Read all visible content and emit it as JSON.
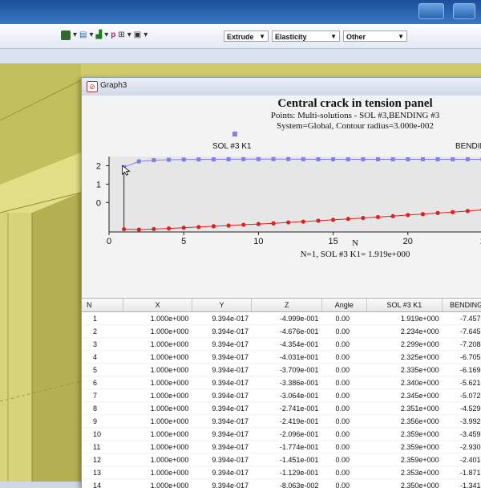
{
  "toolbar": {
    "combo_extrude": "Extrude",
    "combo_elasticity": "Elasticity",
    "combo_other": "Other"
  },
  "graph_window": {
    "title": "Graph3"
  },
  "chart_data": {
    "type": "line",
    "title": "Central crack in tension panel",
    "subtitle_lines": [
      "Points: Multi-solutions - SOL #3,BENDING #3",
      "System=Global, Contour radius=3.000e-002"
    ],
    "xlabel": "N",
    "footer": "N=1, SOL #3 K1= 1.919e+000",
    "xlim": [
      0,
      25
    ],
    "ylim": [
      -1.6,
      2.5
    ],
    "xticks": [
      0,
      5,
      10,
      15,
      20,
      25
    ],
    "xtick_labels": [
      "0",
      "5",
      "10",
      "15",
      "20",
      "2"
    ],
    "yticks": [
      2,
      1,
      0
    ],
    "series": [
      {
        "name": "SOL #3 K1",
        "color": "#7f7fe6",
        "marker": "square",
        "x": [
          1,
          2,
          3,
          4,
          5,
          6,
          7,
          8,
          9,
          10,
          11,
          12,
          13,
          14,
          15,
          16,
          17,
          18,
          19,
          20,
          21,
          22,
          23,
          24,
          25
        ],
        "values": [
          1.919,
          2.234,
          2.299,
          2.325,
          2.335,
          2.34,
          2.345,
          2.351,
          2.356,
          2.359,
          2.359,
          2.359,
          2.353,
          2.35,
          2.35,
          2.35,
          2.35,
          2.35,
          2.35,
          2.35,
          2.35,
          2.35,
          2.35,
          2.35,
          2.35
        ]
      },
      {
        "name": "BENDING",
        "color": "#e02020",
        "marker": "circle",
        "x": [
          1,
          2,
          3,
          4,
          5,
          6,
          7,
          8,
          9,
          10,
          11,
          12,
          13,
          14,
          15,
          16,
          17,
          18,
          19,
          20,
          21,
          22,
          23,
          24,
          25
        ],
        "values": [
          -1.45,
          -1.47,
          -1.44,
          -1.41,
          -1.37,
          -1.33,
          -1.29,
          -1.25,
          -1.21,
          -1.17,
          -1.13,
          -1.08,
          -1.04,
          -0.99,
          -0.94,
          -0.89,
          -0.84,
          -0.79,
          -0.74,
          -0.68,
          -0.63,
          -0.57,
          -0.52,
          -0.46,
          -0.4
        ]
      }
    ]
  },
  "table": {
    "columns": [
      "N",
      "X",
      "Y",
      "Z",
      "Angle",
      "SOL #3 K1",
      "BENDING"
    ],
    "rows": [
      [
        "1",
        "1.000e+000",
        "9.394e-017",
        "-4.999e-001",
        "0.00",
        "1.919e+000",
        "-7.457e-"
      ],
      [
        "2",
        "1.000e+000",
        "9.394e-017",
        "-4.676e-001",
        "0.00",
        "2.234e+000",
        "-7.645e-"
      ],
      [
        "3",
        "1.000e+000",
        "9.394e-017",
        "-4.354e-001",
        "0.00",
        "2.299e+000",
        "-7.208e-"
      ],
      [
        "4",
        "1.000e+000",
        "9.394e-017",
        "-4.031e-001",
        "0.00",
        "2.325e+000",
        "-6.705e-"
      ],
      [
        "5",
        "1.000e+000",
        "9.394e-017",
        "-3.709e-001",
        "0.00",
        "2.335e+000",
        "-6.169e-"
      ],
      [
        "6",
        "1.000e+000",
        "9.394e-017",
        "-3.386e-001",
        "0.00",
        "2.340e+000",
        "-5.621e-"
      ],
      [
        "7",
        "1.000e+000",
        "9.394e-017",
        "-3.064e-001",
        "0.00",
        "2.345e+000",
        "-5.072e-"
      ],
      [
        "8",
        "1.000e+000",
        "9.394e-017",
        "-2.741e-001",
        "0.00",
        "2.351e+000",
        "-4.529e-"
      ],
      [
        "9",
        "1.000e+000",
        "9.394e-017",
        "-2.419e-001",
        "0.00",
        "2.356e+000",
        "-3.992e-"
      ],
      [
        "10",
        "1.000e+000",
        "9.394e-017",
        "-2.096e-001",
        "0.00",
        "2.359e+000",
        "-3.459e-"
      ],
      [
        "11",
        "1.000e+000",
        "9.394e-017",
        "-1.774e-001",
        "0.00",
        "2.359e+000",
        "-2.930e-"
      ],
      [
        "12",
        "1.000e+000",
        "9.394e-017",
        "-1.451e-001",
        "0.00",
        "2.359e+000",
        "-2.401e-"
      ],
      [
        "13",
        "1.000e+000",
        "9.394e-017",
        "-1.129e-001",
        "0.00",
        "2.353e+000",
        "-1.871e-"
      ],
      [
        "14",
        "1.000e+000",
        "9.394e-017",
        "-8.063e-002",
        "0.00",
        "2.350e+000",
        "-1.341e-"
      ]
    ]
  }
}
